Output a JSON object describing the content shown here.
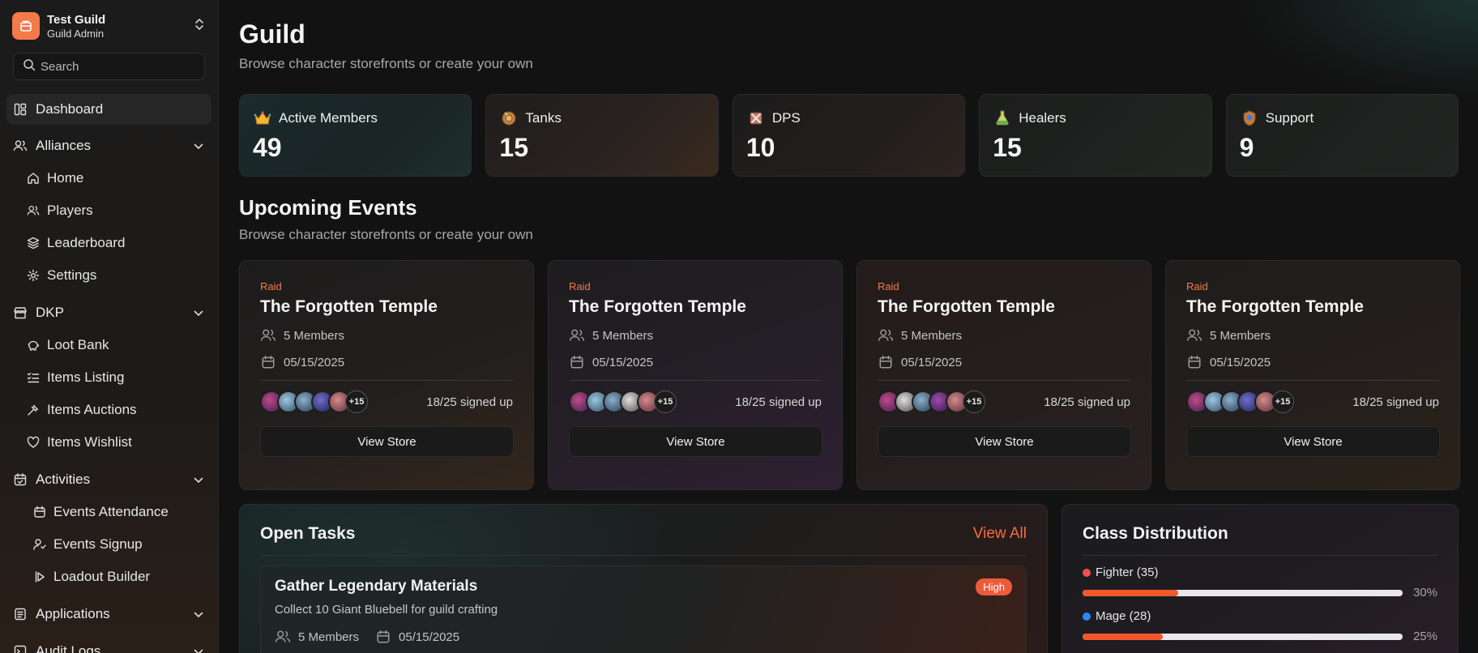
{
  "sidebar": {
    "guild_name": "Test Guild",
    "guild_role": "Guild Admin",
    "search_placeholder": "Search",
    "dashboard": "Dashboard",
    "sections": {
      "alliances": "Alliances",
      "dkp": "DKP",
      "activities": "Activities",
      "applications": "Applications",
      "audit_logs": "Audit Logs"
    },
    "alliances_items": [
      "Home",
      "Players",
      "Leaderboard",
      "Settings"
    ],
    "dkp_items": [
      "Loot Bank",
      "Items Listing",
      "Items Auctions",
      "Items Wishlist"
    ],
    "activities_items": [
      "Events Attendance",
      "Events Signup",
      "Loadout Builder"
    ]
  },
  "page": {
    "title": "Guild",
    "subtitle": "Browse character storefronts or create your own"
  },
  "stats": [
    {
      "label": "Active Members",
      "value": "49",
      "icon": "crown-emoji"
    },
    {
      "label": "Tanks",
      "value": "15",
      "icon": "shield-emoji"
    },
    {
      "label": "DPS",
      "value": "10",
      "icon": "swords-emoji"
    },
    {
      "label": "Healers",
      "value": "15",
      "icon": "potion-emoji"
    },
    {
      "label": "Support",
      "value": "9",
      "icon": "badge-emoji"
    }
  ],
  "events_section": {
    "title": "Upcoming Events",
    "subtitle": "Browse character storefronts or create your own"
  },
  "events": [
    {
      "tag": "Raid",
      "name": "The Forgotten Temple",
      "members": "5 Members",
      "date": "05/15/2025",
      "more": "+15",
      "signed": "18/25 signed up",
      "button": "View Store"
    },
    {
      "tag": "Raid",
      "name": "The Forgotten Temple",
      "members": "5 Members",
      "date": "05/15/2025",
      "more": "+15",
      "signed": "18/25 signed up",
      "button": "View Store"
    },
    {
      "tag": "Raid",
      "name": "The Forgotten Temple",
      "members": "5 Members",
      "date": "05/15/2025",
      "more": "+15",
      "signed": "18/25 signed up",
      "button": "View Store"
    },
    {
      "tag": "Raid",
      "name": "The Forgotten Temple",
      "members": "5 Members",
      "date": "05/15/2025",
      "more": "+15",
      "signed": "18/25 signed up",
      "button": "View Store"
    }
  ],
  "tasks": {
    "title": "Open Tasks",
    "view_all": "View All",
    "items": [
      {
        "name": "Gather Legendary Materials",
        "priority": "High",
        "desc": "Collect 10 Giant Bluebell for guild crafting",
        "members": "5 Members",
        "date": "05/15/2025"
      }
    ]
  },
  "distribution": {
    "title": "Class Distribution",
    "rows": [
      {
        "label": "Fighter (35)",
        "percent": "30%",
        "fraction": 0.3,
        "color": "#f0514a"
      },
      {
        "label": "Mage (28)",
        "percent": "25%",
        "fraction": 0.25,
        "color": "#2f86f6"
      }
    ]
  },
  "colors": {
    "accent": "#f46c3f",
    "badge_high": "#ee5a3a",
    "logo": "#f47a4a"
  }
}
